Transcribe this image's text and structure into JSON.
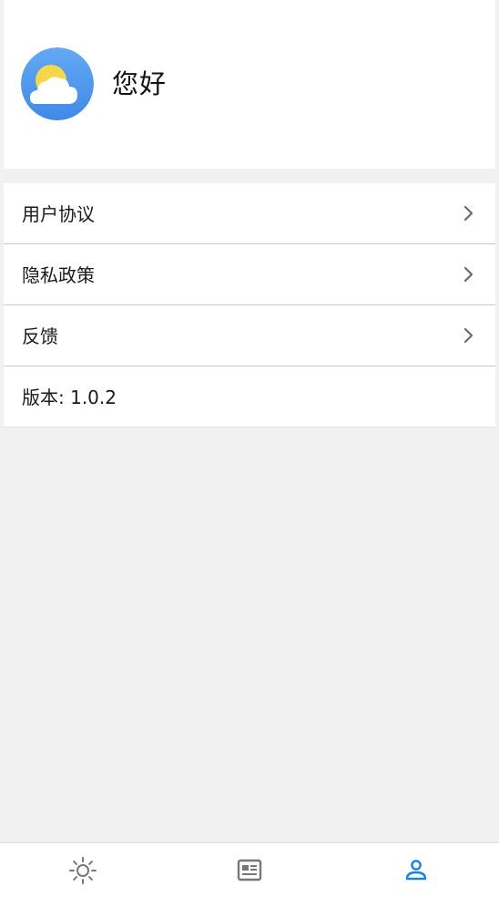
{
  "header": {
    "greeting": "您好",
    "avatar_icon": "partly-cloudy-icon"
  },
  "menu": {
    "items": [
      {
        "label": "用户协议",
        "icon": "chevron-right-icon"
      },
      {
        "label": "隐私政策",
        "icon": "chevron-right-icon"
      },
      {
        "label": "反馈",
        "icon": "chevron-right-icon"
      }
    ],
    "version_label": "版本: 1.0.2"
  },
  "tabbar": {
    "tabs": [
      {
        "icon": "sun-icon",
        "active": false
      },
      {
        "icon": "news-icon",
        "active": false
      },
      {
        "icon": "person-icon",
        "active": true
      }
    ]
  },
  "colors": {
    "accent": "#1b82e8",
    "inactive_icon": "#777777",
    "background": "#f1f1f1"
  }
}
